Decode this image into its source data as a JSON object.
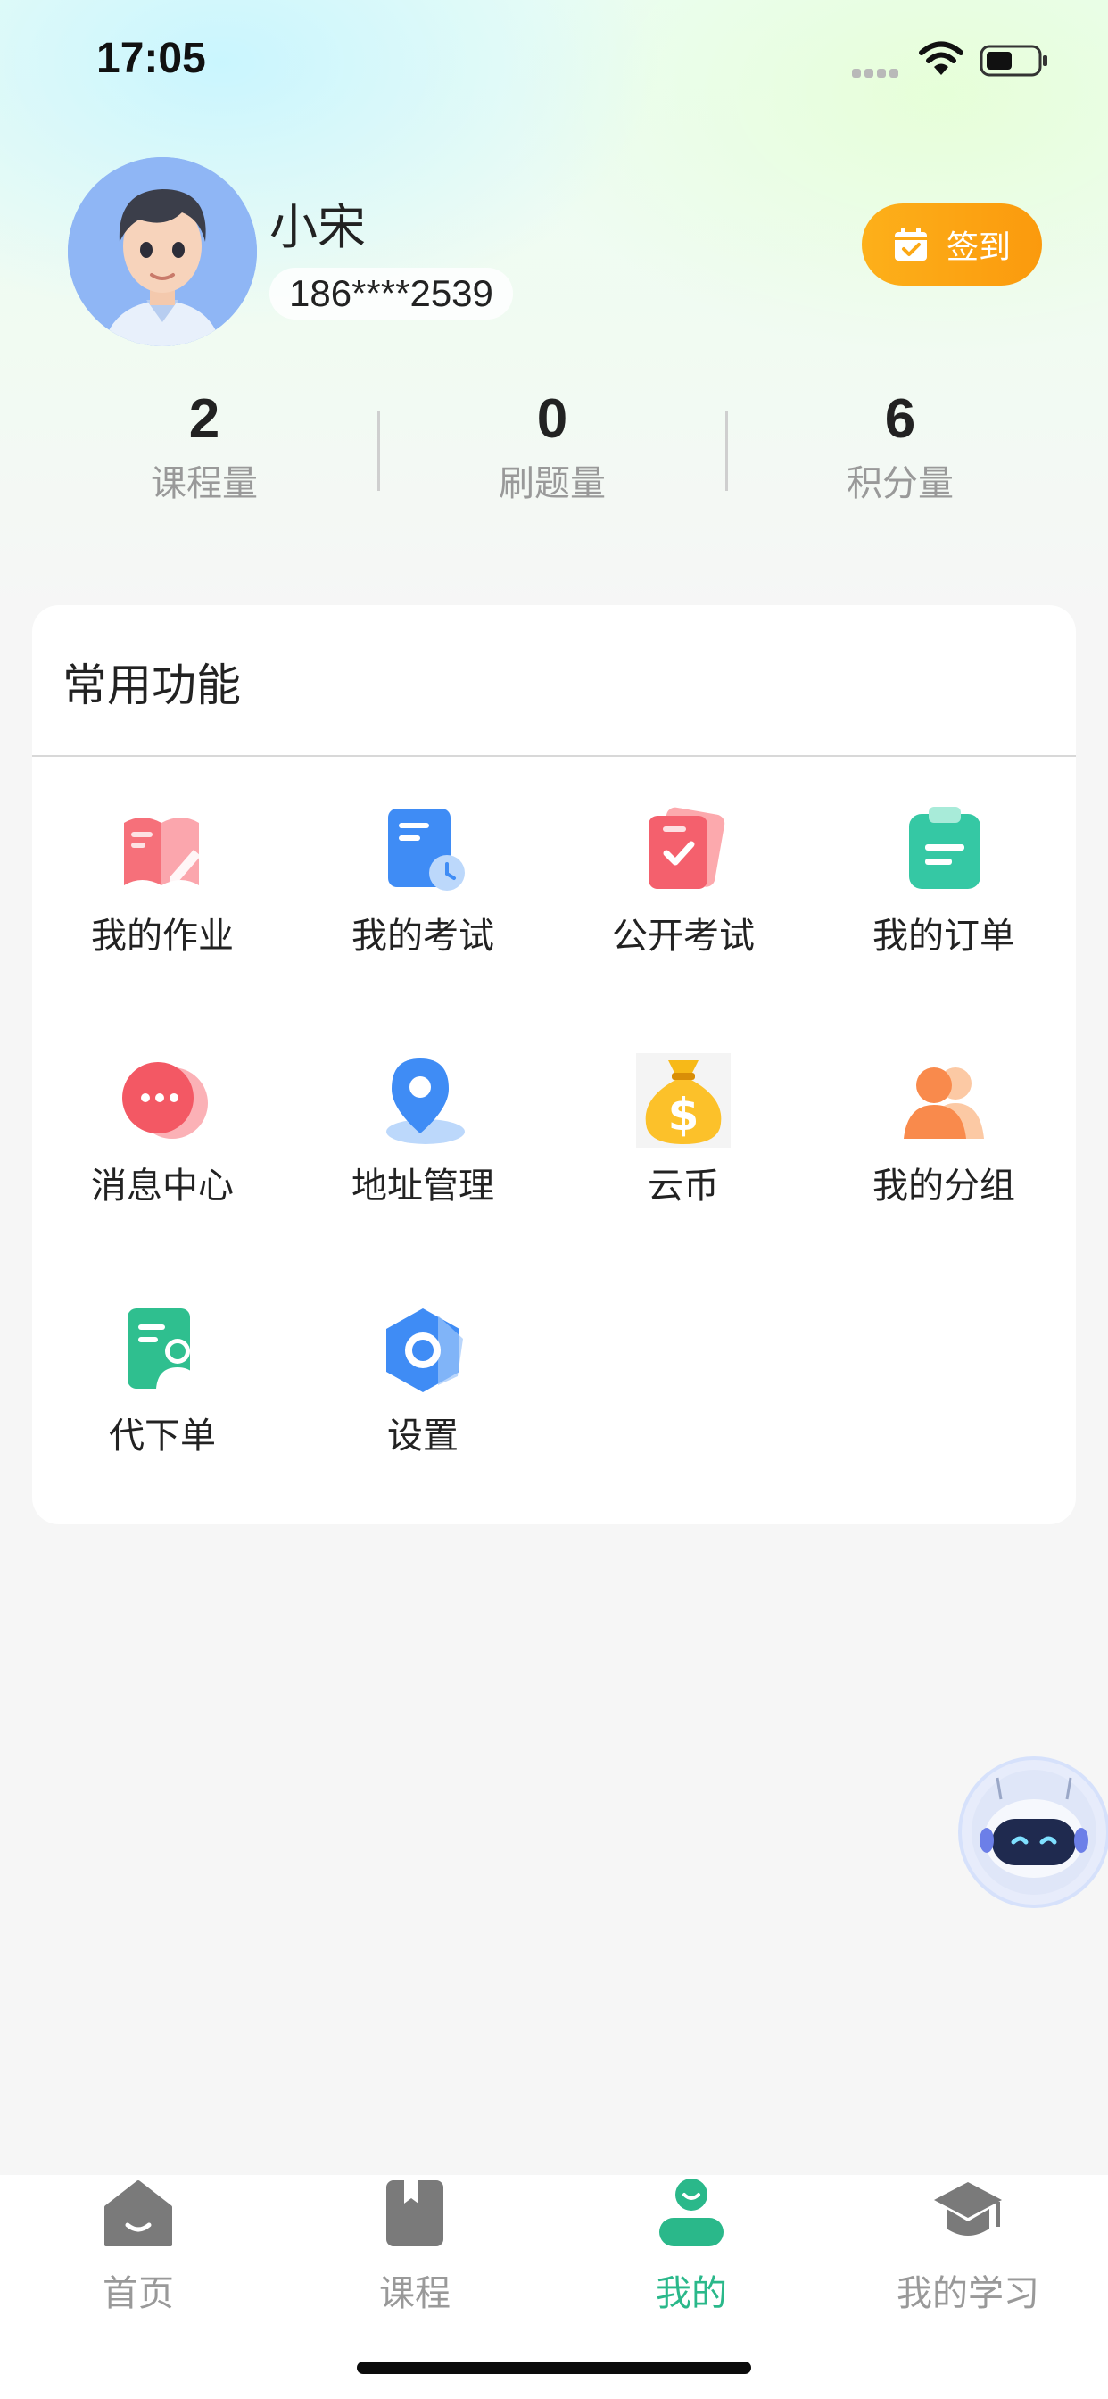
{
  "status_bar": {
    "time": "17:05",
    "signal_icon": "signal-dots-icon",
    "wifi_icon": "wifi-icon",
    "battery_icon": "battery-icon"
  },
  "profile": {
    "name": "小宋",
    "phone": "186****2539",
    "avatar_icon": "avatar-boy-icon",
    "checkin_label": "签到",
    "checkin_icon": "calendar-check-icon",
    "checkin_color": "#fca815"
  },
  "stats": [
    {
      "value": "2",
      "label": "课程量"
    },
    {
      "value": "0",
      "label": "刷题量"
    },
    {
      "value": "6",
      "label": "积分量"
    }
  ],
  "functions": {
    "title": "常用功能",
    "items": [
      {
        "label": "我的作业",
        "icon": "homework-book-icon"
      },
      {
        "label": "我的考试",
        "icon": "exam-clock-icon"
      },
      {
        "label": "公开考试",
        "icon": "public-exam-icon"
      },
      {
        "label": "我的订单",
        "icon": "order-clipboard-icon"
      },
      {
        "label": "消息中心",
        "icon": "message-bubble-icon"
      },
      {
        "label": "地址管理",
        "icon": "location-pin-icon"
      },
      {
        "label": "云币",
        "icon": "money-bag-icon"
      },
      {
        "label": "我的分组",
        "icon": "group-people-icon"
      },
      {
        "label": "代下单",
        "icon": "proxy-order-icon"
      },
      {
        "label": "设置",
        "icon": "settings-hexagon-icon"
      }
    ]
  },
  "assistant": {
    "icon": "robot-assistant-icon"
  },
  "tab_bar": {
    "active_color": "#2ab88a",
    "tabs": [
      {
        "label": "首页",
        "icon": "home-icon"
      },
      {
        "label": "课程",
        "icon": "bookmark-book-icon"
      },
      {
        "label": "我的",
        "icon": "person-icon",
        "active": true
      },
      {
        "label": "我的学习",
        "icon": "graduation-cap-icon"
      }
    ]
  }
}
